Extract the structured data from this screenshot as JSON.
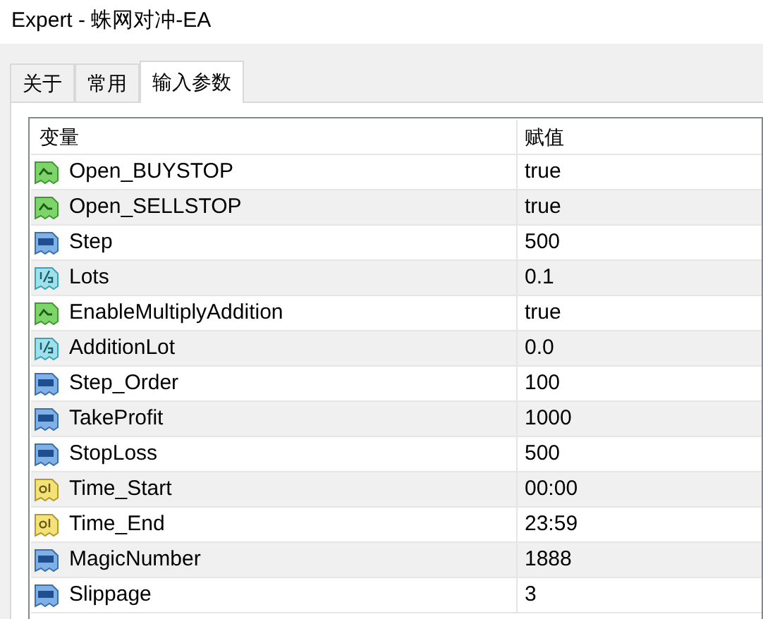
{
  "window": {
    "title": "Expert - 蛛网对冲-EA"
  },
  "tabs": [
    {
      "label": "关于",
      "selected": false
    },
    {
      "label": "常用",
      "selected": false
    },
    {
      "label": "输入参数",
      "selected": true
    }
  ],
  "table": {
    "columns": [
      "变量",
      "赋值"
    ],
    "rows": [
      {
        "kind": "bool",
        "name": "Open_BUYSTOP",
        "value": "true"
      },
      {
        "kind": "bool",
        "name": "Open_SELLSTOP",
        "value": "true"
      },
      {
        "kind": "int",
        "name": "Step",
        "value": "500"
      },
      {
        "kind": "double",
        "name": "Lots",
        "value": "0.1"
      },
      {
        "kind": "bool",
        "name": "EnableMultiplyAddition",
        "value": "true"
      },
      {
        "kind": "double",
        "name": "AdditionLot",
        "value": "0.0"
      },
      {
        "kind": "int",
        "name": "Step_Order",
        "value": "100"
      },
      {
        "kind": "int",
        "name": "TakeProfit",
        "value": "1000"
      },
      {
        "kind": "int",
        "name": "StopLoss",
        "value": "500"
      },
      {
        "kind": "string",
        "name": "Time_Start",
        "value": "00:00"
      },
      {
        "kind": "string",
        "name": "Time_End",
        "value": "23:59"
      },
      {
        "kind": "int",
        "name": "MagicNumber",
        "value": "1888"
      },
      {
        "kind": "int",
        "name": "Slippage",
        "value": "3"
      }
    ]
  }
}
